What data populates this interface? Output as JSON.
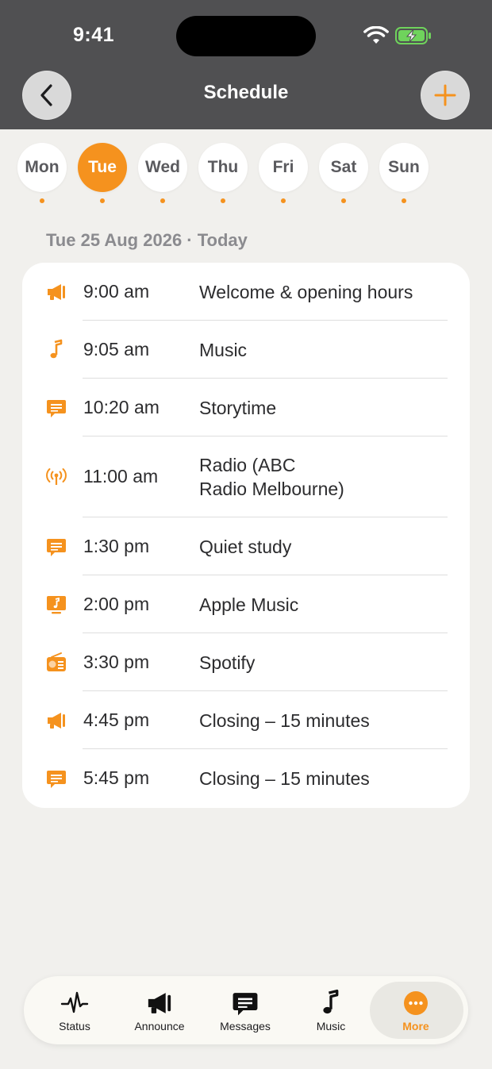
{
  "status_bar": {
    "time": "9:41"
  },
  "nav": {
    "title": "Schedule",
    "back_icon": "chevron-left-icon",
    "add_icon": "plus-icon"
  },
  "colors": {
    "accent": "#f5921e",
    "header": "#505052",
    "background": "#f1f0ed"
  },
  "days": {
    "items": [
      {
        "label": "Mon",
        "active": false
      },
      {
        "label": "Tue",
        "active": true
      },
      {
        "label": "Wed",
        "active": false
      },
      {
        "label": "Thu",
        "active": false
      },
      {
        "label": "Fri",
        "active": false
      },
      {
        "label": "Sat",
        "active": false
      },
      {
        "label": "Sun",
        "active": false
      }
    ]
  },
  "date_heading": "Tue 25 Aug 2026 · Today",
  "schedule": [
    {
      "time": "9:00 am",
      "title": "Welcome & opening hours",
      "icon": "megaphone-icon"
    },
    {
      "time": "9:05 am",
      "title": "Music",
      "icon": "music-note-icon"
    },
    {
      "time": "10:20 am",
      "title": "Storytime",
      "icon": "message-icon"
    },
    {
      "time": "11:00 am",
      "title": "Radio (ABC\nRadio Melbourne)",
      "icon": "broadcast-icon"
    },
    {
      "time": "1:30 pm",
      "title": "Quiet study",
      "icon": "message-icon"
    },
    {
      "time": "2:00 pm",
      "title": "Apple Music",
      "icon": "music-screen-icon"
    },
    {
      "time": "3:30 pm",
      "title": "Spotify",
      "icon": "radio-icon"
    },
    {
      "time": "4:45 pm",
      "title": "Closing – 15 minutes",
      "icon": "megaphone-icon"
    },
    {
      "time": "5:45 pm",
      "title": "Closing – 15 minutes",
      "icon": "message-icon"
    }
  ],
  "tabs": [
    {
      "label": "Status",
      "icon": "pulse-icon",
      "selected": false
    },
    {
      "label": "Announce",
      "icon": "megaphone-icon",
      "selected": false
    },
    {
      "label": "Messages",
      "icon": "message-icon",
      "selected": false
    },
    {
      "label": "Music",
      "icon": "music-note-icon",
      "selected": false
    },
    {
      "label": "More",
      "icon": "more-icon",
      "selected": true
    }
  ]
}
